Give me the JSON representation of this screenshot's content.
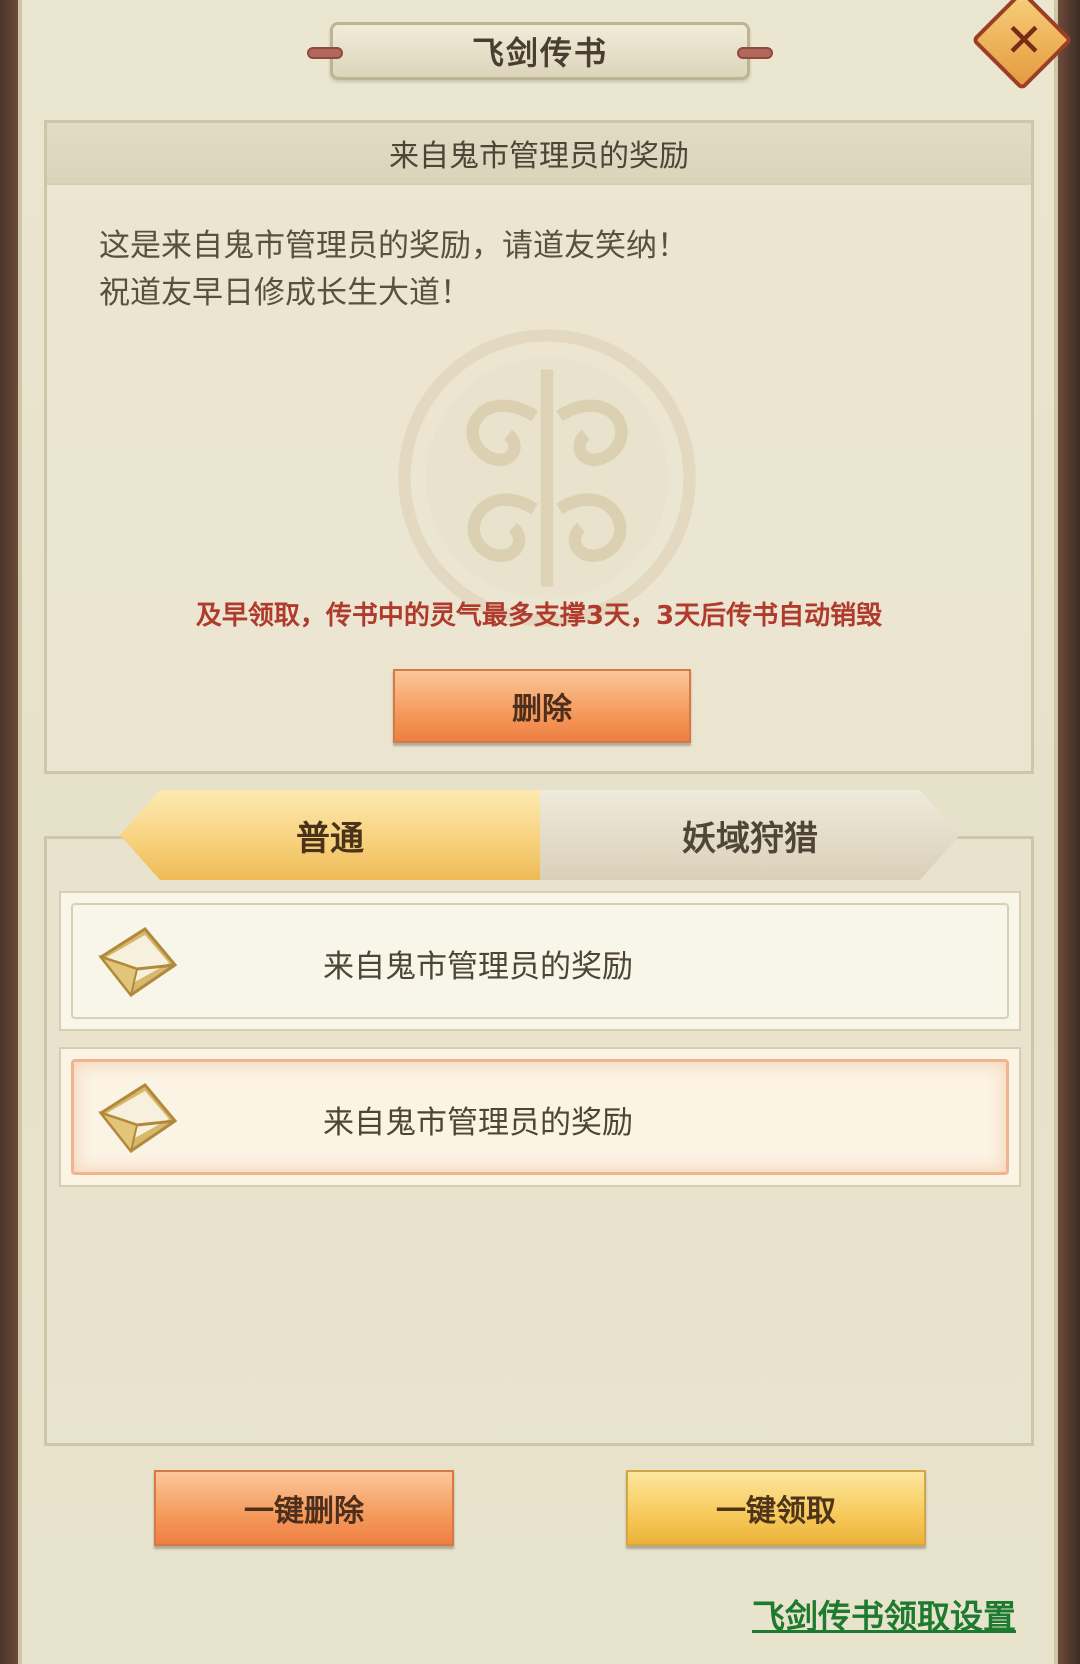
{
  "window": {
    "title": "飞剑传书",
    "close_label": "✕"
  },
  "detail": {
    "header": "来自鬼市管理员的奖励",
    "body_line1": "这是来自鬼市管理员的奖励，请道友笑纳！",
    "body_line2": "祝道友早日修成长生大道！",
    "warning": "及早领取，传书中的灵气最多支撑3天，3天后传书自动销毁",
    "delete_label": "删除"
  },
  "tabs": [
    {
      "label": "普通",
      "active": true
    },
    {
      "label": "妖域狩猎",
      "active": false
    }
  ],
  "mail_list": [
    {
      "title": "来自鬼市管理员的奖励",
      "icon": "envelope-icon",
      "selected": false
    },
    {
      "title": "来自鬼市管理员的奖励",
      "icon": "envelope-icon",
      "selected": true
    }
  ],
  "actions": {
    "bulk_delete": "一键删除",
    "bulk_claim": "一键领取",
    "settings_link": "飞剑传书领取设置"
  },
  "colors": {
    "warning": "#b03a2c",
    "link": "#1d7a2f",
    "orange_button": "#f59a5c",
    "gold_button": "#f7c95a"
  }
}
